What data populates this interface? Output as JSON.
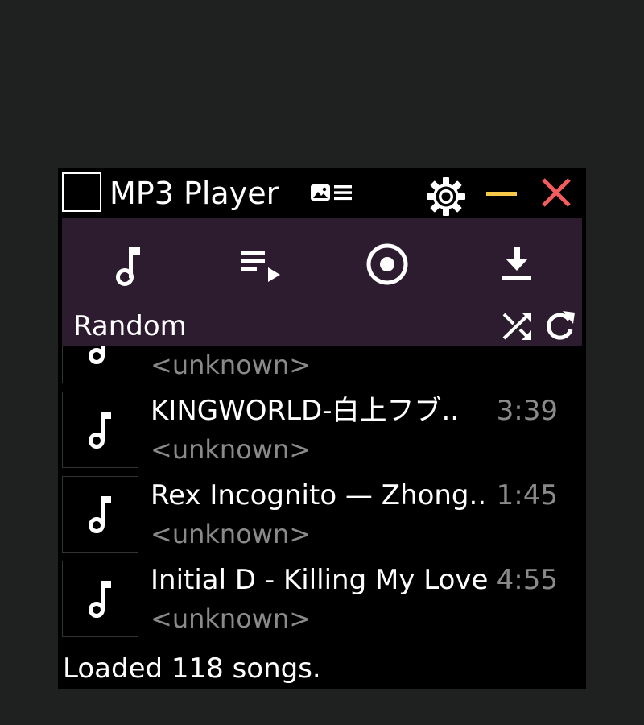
{
  "window": {
    "title": "MP3 Player",
    "buttons": {
      "settings": "gear-icon",
      "minimize": "minimize-icon",
      "close": "close-icon"
    },
    "colors": {
      "background": "#000000",
      "toolbar": "#2d1b2f",
      "minimize": "#f7c94b",
      "close": "#f25c5c",
      "muted_text": "#8a8a8a"
    }
  },
  "toolbar": {
    "buttons": [
      "music-note-icon",
      "playlist-play-icon",
      "record-icon",
      "download-icon"
    ],
    "mode_label": "Random",
    "mode_controls": [
      "shuffle-icon",
      "refresh-icon"
    ]
  },
  "songs": [
    {
      "title": "",
      "artist": "<unknown>",
      "duration": ""
    },
    {
      "title": "KINGWORLD-白上フブ..",
      "artist": "<unknown>",
      "duration": "3:39"
    },
    {
      "title": "Rex Incognito — Zhong..",
      "artist": "<unknown>",
      "duration": "1:45"
    },
    {
      "title": "Initial D - Killing My Love",
      "artist": "<unknown>",
      "duration": "4:55"
    }
  ],
  "status": "Loaded 118 songs."
}
